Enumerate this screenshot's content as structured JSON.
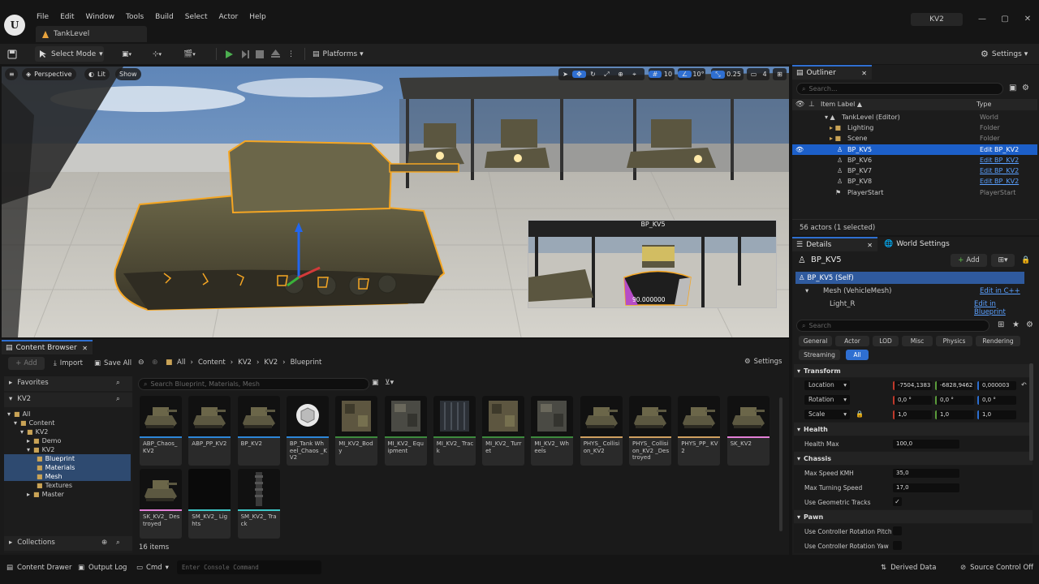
{
  "window": {
    "title": "KV2",
    "minimize": "—",
    "maximize": "▢",
    "close": "✕"
  },
  "menu": [
    "File",
    "Edit",
    "Window",
    "Tools",
    "Build",
    "Select",
    "Actor",
    "Help"
  ],
  "level_tab": "TankLevel",
  "toolbar": {
    "select_mode": "Select Mode",
    "platforms": "Platforms",
    "settings": "Settings"
  },
  "viewport": {
    "perspective": "Perspective",
    "lit": "Lit",
    "show": "Show",
    "grid_size": "10",
    "rotation_snap": "10°",
    "scale_snap": "0.25",
    "camera_speed": "4",
    "preview_title": "BP_KV5",
    "preview_value": "90.000000"
  },
  "outliner": {
    "tab": "Outliner",
    "search_placeholder": "Search...",
    "col_label": "Item Label ▲",
    "col_type": "Type",
    "rows": [
      {
        "label": "TankLevel (Editor)",
        "type": "World"
      },
      {
        "label": "Lighting",
        "type": "Folder"
      },
      {
        "label": "Scene",
        "type": "Folder"
      },
      {
        "label": "BP_KV5",
        "type": "Edit BP_KV2"
      },
      {
        "label": "BP_KV6",
        "type": "Edit BP_KV2"
      },
      {
        "label": "BP_KV7",
        "type": "Edit BP_KV2"
      },
      {
        "label": "BP_KV8",
        "type": "Edit BP_KV2"
      },
      {
        "label": "PlayerStart",
        "type": "PlayerStart"
      }
    ],
    "footer": "56 actors (1 selected)"
  },
  "details": {
    "tab": "Details",
    "world_settings_tab": "World Settings",
    "actor_name": "BP_KV5",
    "add_button": "Add",
    "components": [
      {
        "label": "BP_KV5 (Self)",
        "action": ""
      },
      {
        "label": "Mesh (VehicleMesh)",
        "action": "Edit in C++"
      },
      {
        "label": "Light_R",
        "action": "Edit in Blueprint"
      }
    ],
    "search_placeholder": "Search",
    "categories": [
      "General",
      "Actor",
      "LOD",
      "Misc",
      "Physics",
      "Rendering",
      "Streaming",
      "All"
    ],
    "transform": {
      "section": "Transform",
      "location_label": "Location",
      "location": [
        "-7504,1383",
        "-6828,9462",
        "0,000003"
      ],
      "rotation_label": "Rotation",
      "rotation": [
        "0,0 °",
        "0,0 °",
        "0,0 °"
      ],
      "scale_label": "Scale",
      "scale": [
        "1,0",
        "1,0",
        "1,0"
      ]
    },
    "health": {
      "section": "Health",
      "max_label": "Health Max",
      "max_value": "100,0"
    },
    "chassis": {
      "section": "Chassis",
      "speed_label": "Max Speed KMH",
      "speed_value": "35,0",
      "turn_label": "Max Turning Speed",
      "turn_value": "17,0",
      "tracks_label": "Use Geometric Tracks",
      "tracks_checked": true
    },
    "pawn": {
      "section": "Pawn",
      "pitch_label": "Use Controller Rotation Pitch",
      "yaw_label": "Use Controller Rotation Yaw"
    }
  },
  "content_browser": {
    "tab": "Content Browser",
    "add": "Add",
    "import": "Import",
    "save_all": "Save All",
    "breadcrumb": [
      "All",
      "Content",
      "KV2",
      "KV2",
      "Blueprint"
    ],
    "settings": "Settings",
    "favorites": "Favorites",
    "root": "KV2",
    "tree": [
      {
        "label": "All",
        "depth": 0
      },
      {
        "label": "Content",
        "depth": 1
      },
      {
        "label": "KV2",
        "depth": 2
      },
      {
        "label": "Demo",
        "depth": 3
      },
      {
        "label": "KV2",
        "depth": 3
      },
      {
        "label": "Blueprint",
        "depth": 4
      },
      {
        "label": "Materials",
        "depth": 4
      },
      {
        "label": "Mesh",
        "depth": 4
      },
      {
        "label": "Textures",
        "depth": 4
      },
      {
        "label": "Master",
        "depth": 3
      }
    ],
    "collections": "Collections",
    "search_placeholder": "Search Blueprint, Materials, Mesh",
    "item_count": "16 items",
    "assets": [
      {
        "name": "ABP_Chaos_KV2",
        "bar": "#2d86d8",
        "thumb": "tank"
      },
      {
        "name": "ABP_PP_KV2",
        "bar": "#2d86d8",
        "thumb": "tank"
      },
      {
        "name": "BP_KV2",
        "bar": "#2d86d8",
        "thumb": "tank"
      },
      {
        "name": "BP_Tank Wheel_Chaos _KV2",
        "bar": "#2d86d8",
        "thumb": "cube"
      },
      {
        "name": "MI_KV2_Body",
        "bar": "#3d8a3d",
        "thumb": "tex1"
      },
      {
        "name": "MI_KV2_ Equipment",
        "bar": "#3d8a3d",
        "thumb": "tex2"
      },
      {
        "name": "MI_KV2_ Track",
        "bar": "#3d8a3d",
        "thumb": "tex3"
      },
      {
        "name": "MI_KV2_ Turret",
        "bar": "#3d8a3d",
        "thumb": "tex1"
      },
      {
        "name": "MI_KV2_ Wheels",
        "bar": "#3d8a3d",
        "thumb": "tex2"
      },
      {
        "name": "PHYS_ Collision_KV2",
        "bar": "#d0a060",
        "thumb": "tank"
      },
      {
        "name": "PHYS_ Collision_KV2 _Destroyed",
        "bar": "#d0a060",
        "thumb": "tank"
      },
      {
        "name": "PHYS_PP_ KV2",
        "bar": "#d0a060",
        "thumb": "tank"
      },
      {
        "name": "SK_KV2",
        "bar": "#e27fd6",
        "thumb": "tank"
      },
      {
        "name": "SK_KV2_ Destroyed",
        "bar": "#e27fd6",
        "thumb": "tank"
      },
      {
        "name": "SM_KV2_ Lights",
        "bar": "#3cc6c6",
        "thumb": "dark"
      },
      {
        "name": "SM_KV2_ Track",
        "bar": "#3cc6c6",
        "thumb": "track"
      }
    ]
  },
  "statusbar": {
    "content_drawer": "Content Drawer",
    "output_log": "Output Log",
    "cmd": "Cmd",
    "console_placeholder": "Enter Console Command",
    "derived_data": "Derived Data",
    "source_control": "Source Control Off"
  },
  "colors": {
    "accent": "#2f6fd1",
    "selected_row": "#1c5fc9",
    "outline": "#f5a623"
  }
}
